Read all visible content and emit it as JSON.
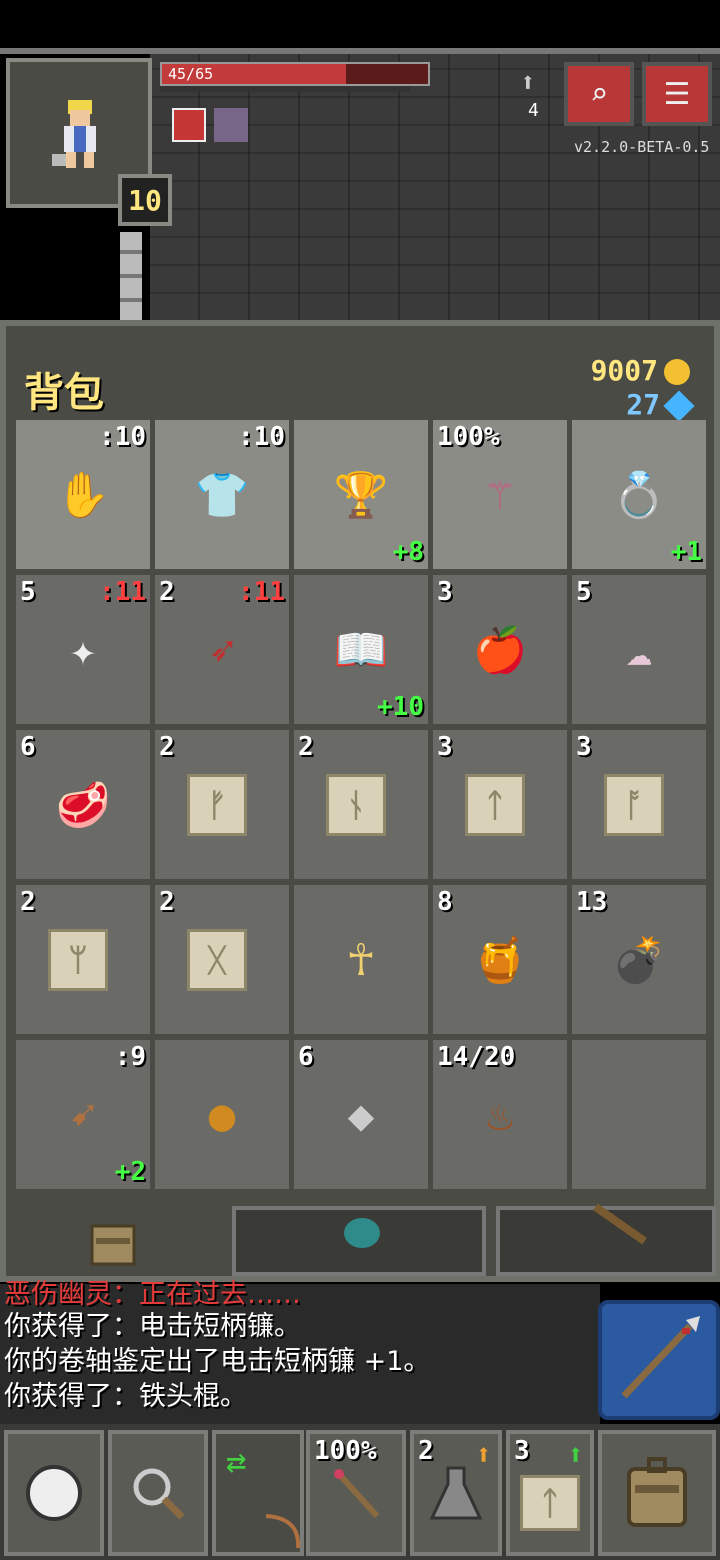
{
  "status": {
    "hp_text": "45/65",
    "hp_fraction": 0.69,
    "level": "10",
    "depth": "4",
    "version": "v2.2.0-BETA-0.5"
  },
  "inventory": {
    "title": "背包",
    "gold": "9007",
    "gems": "27",
    "slots": [
      {
        "name": "gloves",
        "qty": "",
        "lvl": ":10",
        "bonus": "",
        "icon": "glove-icon"
      },
      {
        "name": "armor",
        "qty": "",
        "lvl": ":10",
        "bonus": "",
        "icon": "shirt-icon"
      },
      {
        "name": "cup",
        "qty": "",
        "lvl": "",
        "bonus": "+8",
        "icon": "chalice-icon"
      },
      {
        "name": "wand",
        "qty": "100%",
        "lvl": "",
        "bonus": "",
        "icon": "wand-icon"
      },
      {
        "name": "ring",
        "qty": "",
        "lvl": "",
        "bonus": "+1",
        "icon": "ring-icon"
      },
      {
        "name": "shuriken",
        "qty": "5",
        "lvl": ":11",
        "bonus": "",
        "icon": "shuriken-icon"
      },
      {
        "name": "dart",
        "qty": "2",
        "lvl": ":11",
        "bonus": "",
        "icon": "dart-icon"
      },
      {
        "name": "book",
        "qty": "",
        "lvl": "",
        "bonus": "+10",
        "icon": "book-icon"
      },
      {
        "name": "apple",
        "qty": "3",
        "lvl": "",
        "bonus": "",
        "icon": "apple-icon"
      },
      {
        "name": "wing",
        "qty": "5",
        "lvl": "",
        "bonus": "",
        "icon": "wing-icon"
      },
      {
        "name": "meat",
        "qty": "6",
        "lvl": "",
        "bonus": "",
        "icon": "meat-icon"
      },
      {
        "name": "scroll-1",
        "qty": "2",
        "lvl": "",
        "bonus": "",
        "icon": "scroll-icon",
        "rune": "ᚠ"
      },
      {
        "name": "scroll-2",
        "qty": "2",
        "lvl": "",
        "bonus": "",
        "icon": "scroll-icon",
        "rune": "ᚾ"
      },
      {
        "name": "scroll-3",
        "qty": "3",
        "lvl": "",
        "bonus": "",
        "icon": "scroll-icon",
        "rune": "ᛏ"
      },
      {
        "name": "scroll-4",
        "qty": "3",
        "lvl": "",
        "bonus": "",
        "icon": "scroll-icon",
        "rune": "ᚩ"
      },
      {
        "name": "scroll-5",
        "qty": "2",
        "lvl": "",
        "bonus": "",
        "icon": "scroll-icon",
        "rune": "ᛘ"
      },
      {
        "name": "scroll-6",
        "qty": "2",
        "lvl": "",
        "bonus": "",
        "icon": "scroll-icon",
        "rune": "ᚷ"
      },
      {
        "name": "ankh",
        "qty": "",
        "lvl": "",
        "bonus": "",
        "icon": "ankh-icon"
      },
      {
        "name": "honeypot",
        "qty": "8",
        "lvl": "",
        "bonus": "",
        "icon": "honeypot-icon"
      },
      {
        "name": "bomb",
        "qty": "13",
        "lvl": "",
        "bonus": "",
        "icon": "bomb-icon"
      },
      {
        "name": "bow",
        "qty": "",
        "lvl": ":9",
        "bonus": "+2",
        "icon": "bow-icon"
      },
      {
        "name": "seed",
        "qty": "",
        "lvl": "",
        "bonus": "",
        "icon": "seed-icon"
      },
      {
        "name": "stone",
        "qty": "6",
        "lvl": "",
        "bonus": "",
        "icon": "stone-icon"
      },
      {
        "name": "waterskin",
        "qty": "14/20",
        "lvl": "",
        "bonus": "",
        "icon": "waterskin-icon"
      },
      {
        "name": "empty",
        "qty": "",
        "lvl": "",
        "bonus": "",
        "icon": ""
      }
    ]
  },
  "log": {
    "line0": "恶伤幽灵：正在过去……",
    "line1": "你获得了：电击短柄镰。",
    "line2": "你的卷轴鉴定出了电击短柄镰 +1。",
    "line3": "你获得了：铁头棍。"
  },
  "toolbar": {
    "quick1_charge": "100%",
    "quick2_qty": "2",
    "quick3_qty": "3"
  },
  "colors": {
    "panel": "#4a4b45",
    "slot": "#6a6b66",
    "equip_slot": "#8b8c86",
    "gold_text": "#ffe680",
    "bonus_text": "#44ff44",
    "hp": "#c23a3a"
  }
}
